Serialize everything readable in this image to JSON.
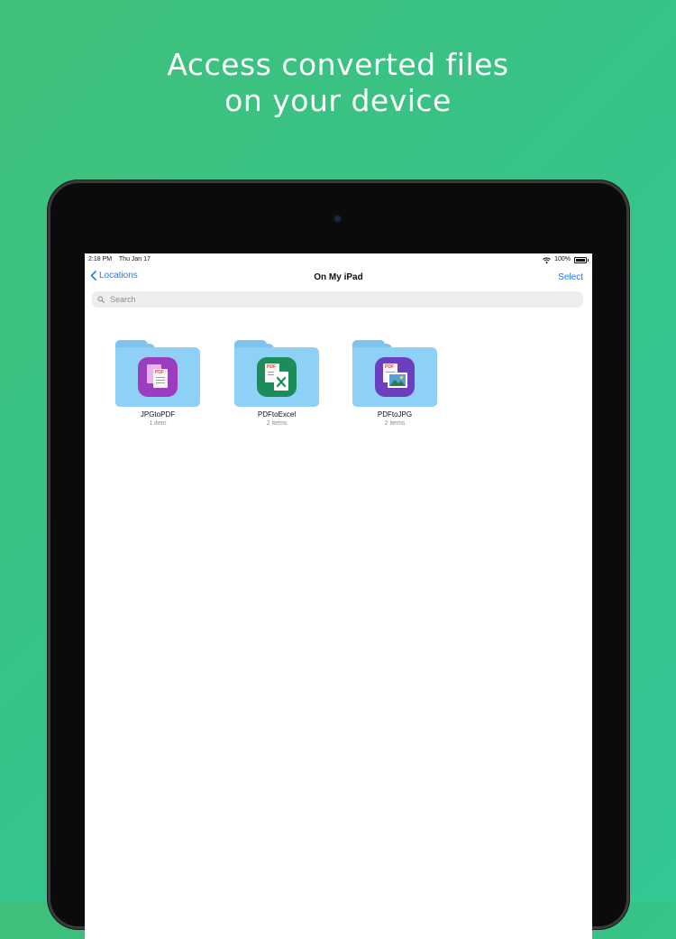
{
  "headline": {
    "line1": "Access converted files",
    "line2": "on your device"
  },
  "status_bar": {
    "time": "2:18 PM",
    "date": "Thu Jan 17",
    "battery": "100%",
    "wifi_icon": "wifi-icon"
  },
  "nav": {
    "back_label": "Locations",
    "title": "On My iPad",
    "select_label": "Select"
  },
  "search": {
    "placeholder": "Search"
  },
  "folders": [
    {
      "name": "JPGtoPDF",
      "count": "1 item",
      "badge_color": "#9c3dbf",
      "icon": "jpg-to-pdf-app-icon"
    },
    {
      "name": "PDFtoExcel",
      "count": "2 items",
      "badge_color": "#1b8c5a",
      "icon": "pdf-to-excel-app-icon"
    },
    {
      "name": "PDFtoJPG",
      "count": "2 items",
      "badge_color": "#6c3fbf",
      "icon": "pdf-to-jpg-app-icon"
    }
  ],
  "colors": {
    "background": "#3fc07a",
    "accent": "#1a7cf4",
    "folder": "#8ed0f6"
  }
}
